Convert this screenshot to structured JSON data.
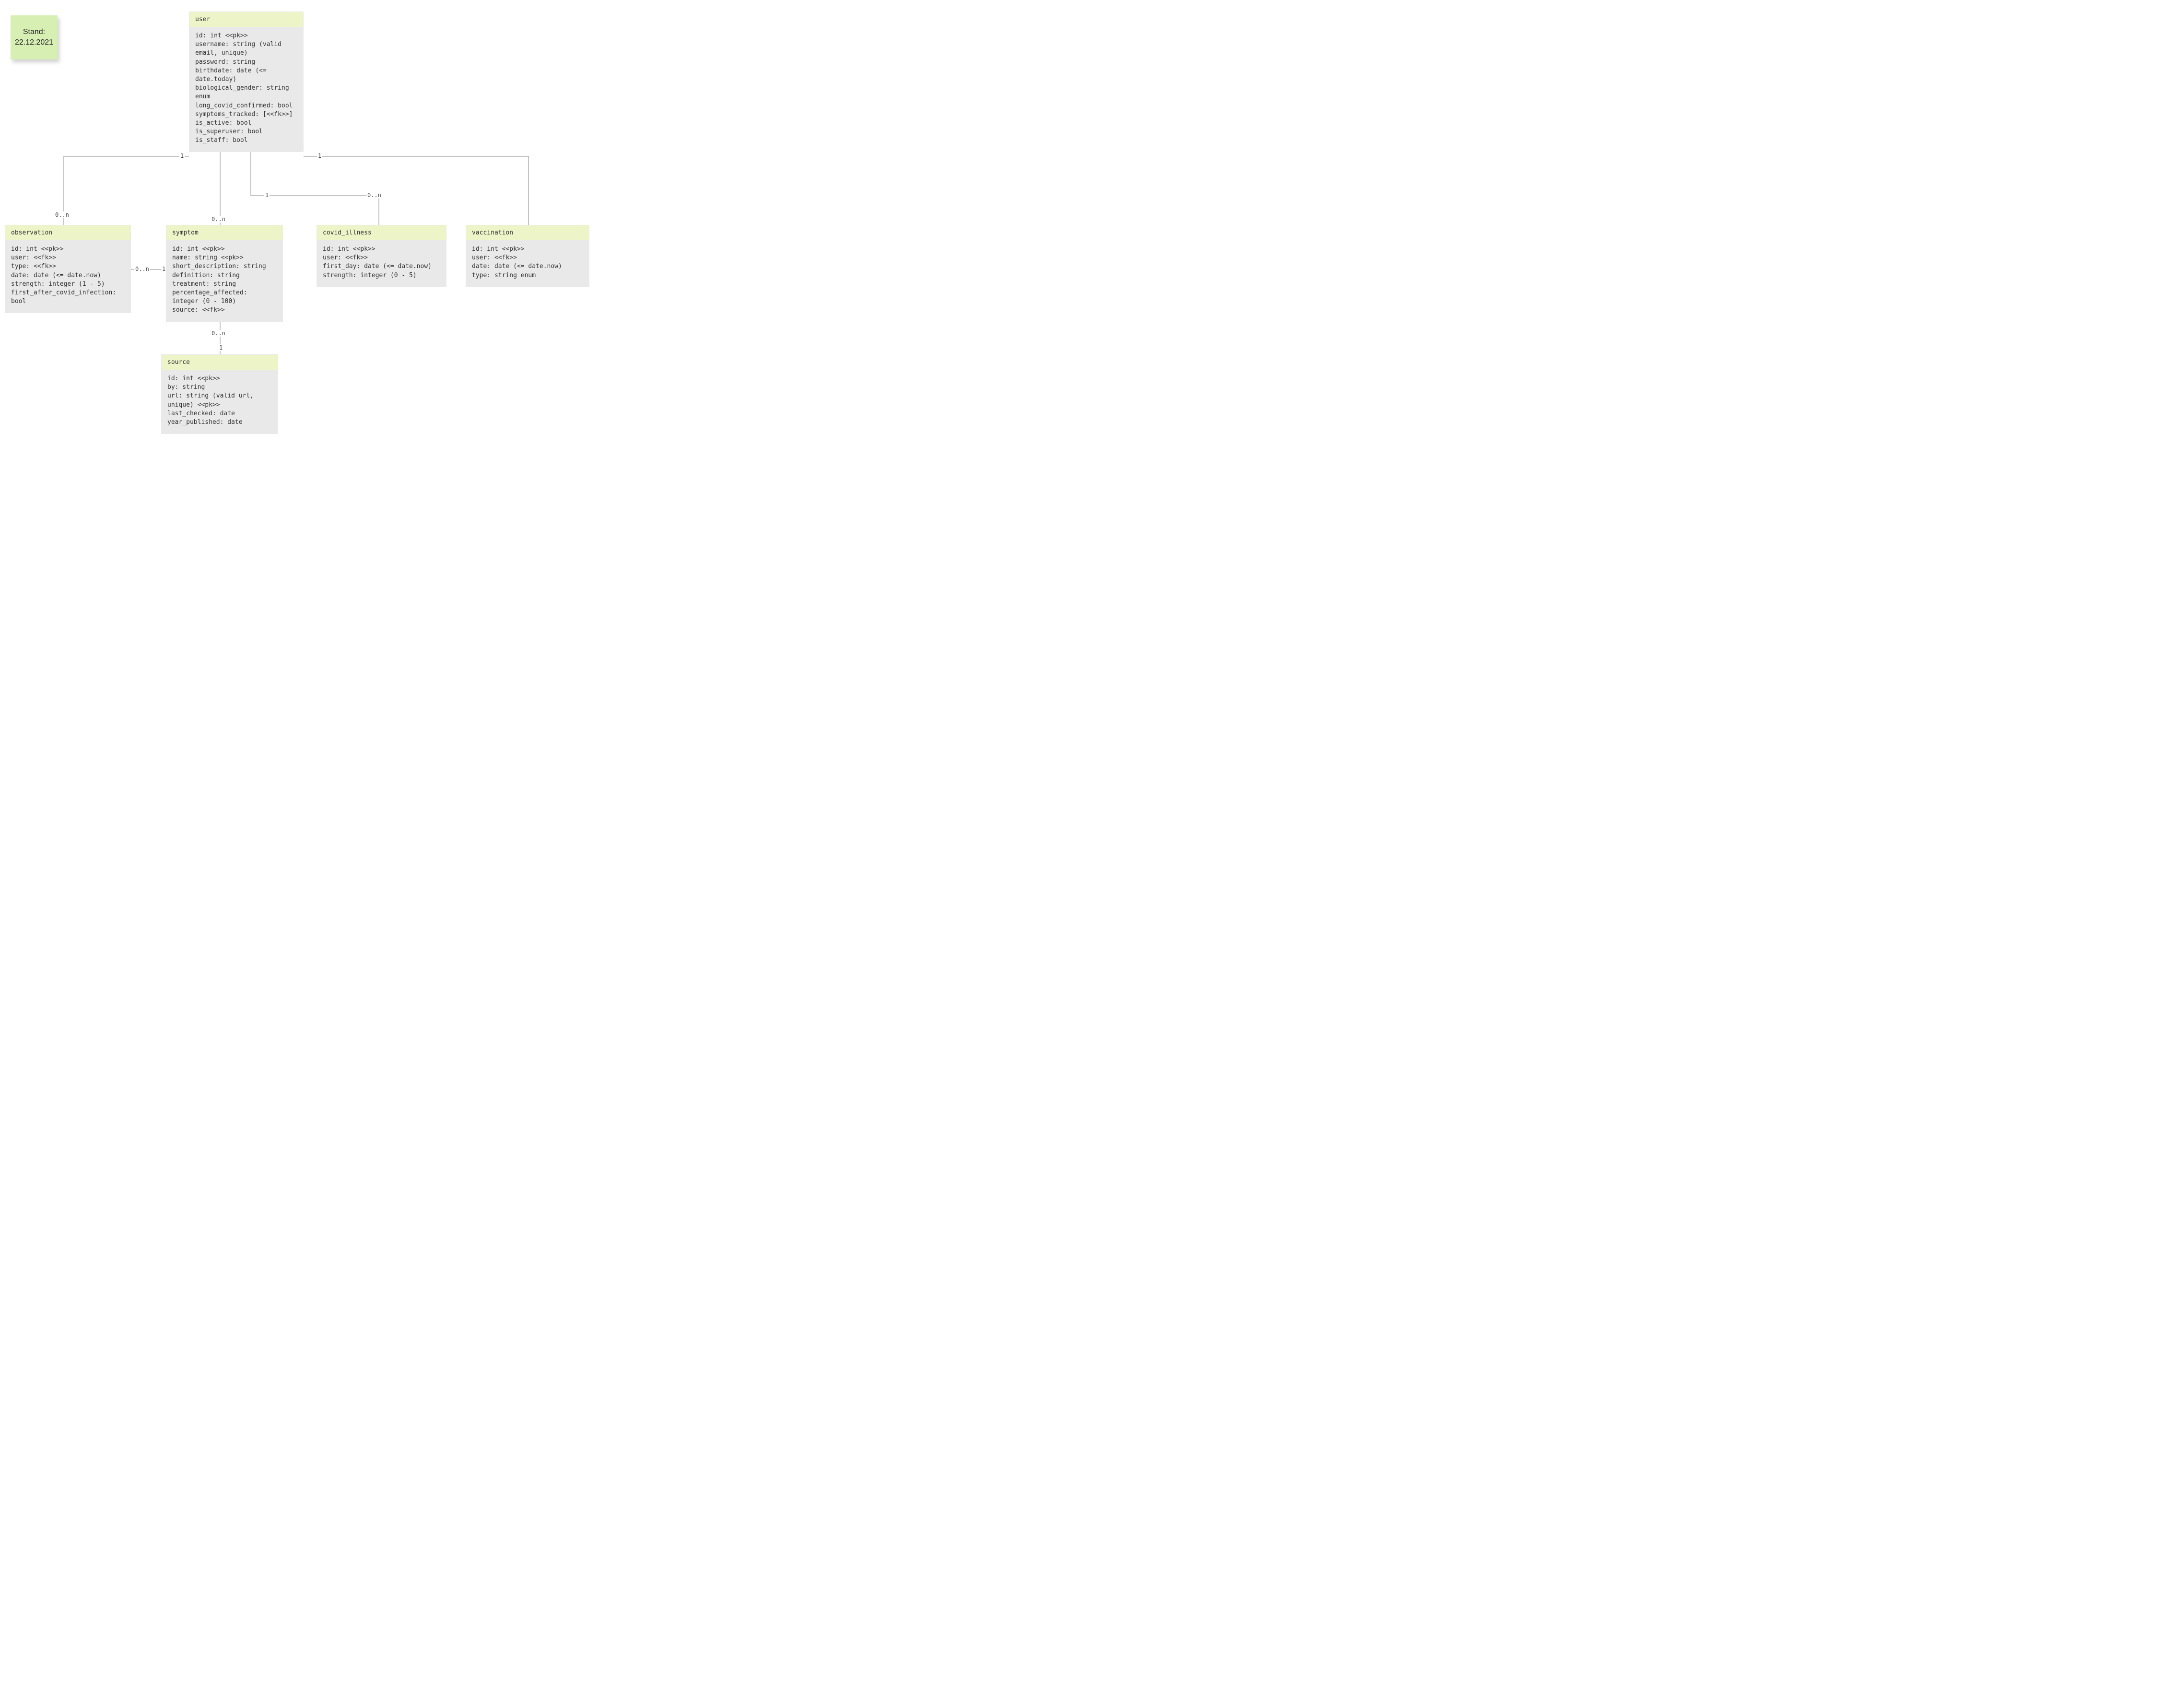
{
  "sticky": {
    "line1": "Stand:",
    "line2": "22.12.2021"
  },
  "entities": {
    "user": {
      "title": "user",
      "body": "id: int <<pk>>\nusername: string (valid email, unique)\npassword: string\nbirthdate: date (<= date.today)\nbiological_gender: string enum\nlong_covid_confirmed: bool\nsymptoms_tracked: [<<fk>>]\nis_active: bool\nis_superuser: bool\nis_staff: bool"
    },
    "observation": {
      "title": "observation",
      "body": "id: int <<pk>>\nuser: <<fk>>\ntype: <<fk>>\ndate: date (<= date.now)\nstrength: integer (1 - 5)\nfirst_after_covid_infection: bool"
    },
    "symptom": {
      "title": "symptom",
      "body": "id: int <<pk>>\nname: string <<pk>>\nshort_description: string\ndefinition: string\ntreatment: string\npercentage_affected: integer (0 - 100)\nsource: <<fk>>"
    },
    "covid_illness": {
      "title": "covid_illness",
      "body": "id: int <<pk>>\nuser: <<fk>>\nfirst_day: date (<= date.now)\nstrength: integer (0 - 5)"
    },
    "vaccination": {
      "title": "vaccination",
      "body": "id: int <<pk>>\nuser: <<fk>>\ndate: date (<= date.now)\ntype: string enum"
    },
    "source": {
      "title": "source",
      "body": "id: int <<pk>>\nby: string\nurl: string (valid url, unique) <<pk>>\nlast_checked: date\nyear_published: date"
    }
  },
  "cardinalities": {
    "user_left_1": "1",
    "user_right_1": "1",
    "obs_0n": "0..n",
    "sym_0n": "0..n",
    "cov_1": "1",
    "cov_0n": "0..n",
    "obs_sym_0n": "0..n",
    "obs_sym_1": "1",
    "sym_src_0n": "0..n",
    "sym_src_1": "1"
  }
}
